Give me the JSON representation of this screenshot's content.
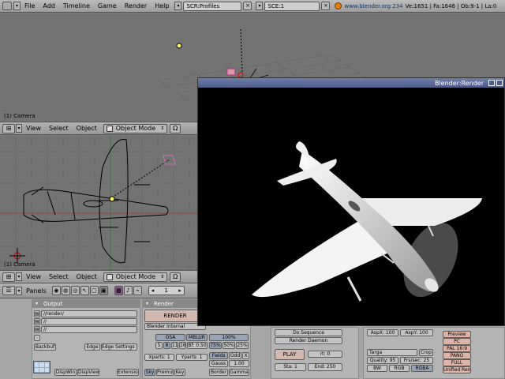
{
  "topbar": {
    "menus": [
      "File",
      "Add",
      "Timeline",
      "Game",
      "Render",
      "Help"
    ],
    "screen": "SCR:Profiles",
    "scene": "SCE:1",
    "url": "www.blender.org 234",
    "stats": "Ve:1651 | Fa:1646 | Ob:9-1 | La:0"
  },
  "view_top": {
    "label": "(1) Camera"
  },
  "view_bottom": {
    "label": "(1) Camera"
  },
  "header3d": {
    "view": "View",
    "select": "Select",
    "object": "Object",
    "mode": "Object Mode"
  },
  "buttons": {
    "panels_label": "Panels",
    "frame": "1",
    "output": {
      "title": "Output",
      "paths": [
        "//render/",
        "//",
        "//"
      ],
      "backbuf": "Backbuf",
      "edge": "Edge",
      "edge_settings": "Edge Settings >",
      "dispwin": "DispWin",
      "dispview": "DispView",
      "extensions": "Extensio"
    },
    "render": {
      "title": "Render",
      "render_btn": "RENDER",
      "engine": "Blender Internal",
      "osa": "OSA",
      "mblur": "MBLUR",
      "osa_levels": [
        "5",
        "8",
        "11",
        "16"
      ],
      "bf": "Bf: 0.50",
      "percent": "100%",
      "percents": [
        "75%",
        "50%",
        "25%"
      ],
      "xparts": "Xparts: 1",
      "yparts": "Yparts: 1",
      "fields": "Fields",
      "odd": "Odd",
      "x": "X",
      "gauss": "Gauss",
      "gauss_val": "1.00",
      "sky": "Sky",
      "premul": "Premul",
      "key": "Key",
      "border": "Border",
      "gamma": "Gamma"
    },
    "anim": {
      "do_sequence": "Do Sequence",
      "render_daemon": "Render Daemon",
      "play": "PLAY",
      "rt": "rt: 0",
      "sta": "Sta: 1",
      "end": "End: 250"
    },
    "format": {
      "aspx": "AspX: 100",
      "aspy": "AspY: 100",
      "type": "Targa",
      "crop": "Crop",
      "quality": "Quality: 95",
      "fps": "Frs/sec: 25",
      "bw": "BW",
      "rgb": "RGB",
      "rgba": "RGBA",
      "presets": [
        "Preview",
        "PC",
        "PAL 16:9",
        "PANO",
        "FULL",
        "Unified Ren"
      ]
    }
  },
  "render_window": {
    "title": "Blender:Render"
  },
  "colors": {
    "accent": "#4c5b8a",
    "viewport": "#737373",
    "render_bg": "#000000"
  }
}
